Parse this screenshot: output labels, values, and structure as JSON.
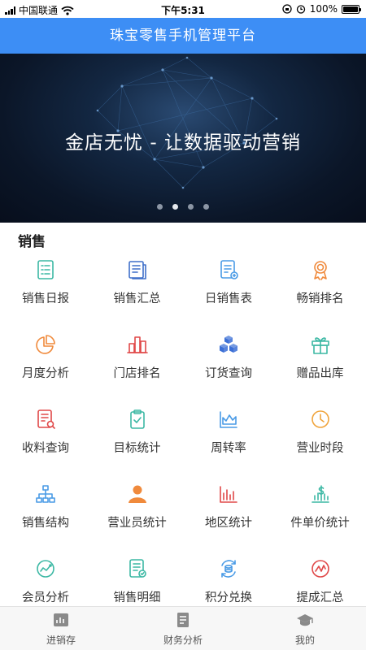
{
  "status_bar": {
    "carrier": "中国联通",
    "time": "下午5:31",
    "battery": "100%",
    "battery_level": 1.0
  },
  "header": {
    "title": "珠宝零售手机管理平台"
  },
  "banner": {
    "text": "金店无忧 - 让数据驱动营销",
    "dot_count": 4,
    "active_dot": 2
  },
  "section": {
    "title": "销售"
  },
  "menu": [
    {
      "label": "销售日报",
      "icon": "daily-report-icon",
      "color": "#3cb8a4"
    },
    {
      "label": "销售汇总",
      "icon": "summary-document-icon",
      "color": "#3f6fc9"
    },
    {
      "label": "日销售表",
      "icon": "daily-sales-sheet-icon",
      "color": "#4a9be6"
    },
    {
      "label": "畅销排名",
      "icon": "award-ribbon-icon",
      "color": "#f08a3c"
    },
    {
      "label": "月度分析",
      "icon": "pie-chart-icon",
      "color": "#f08a3c"
    },
    {
      "label": "门店排名",
      "icon": "store-ranking-icon",
      "color": "#e04848"
    },
    {
      "label": "订货查询",
      "icon": "cubes-icon",
      "color": "#3b6fd6"
    },
    {
      "label": "赠品出库",
      "icon": "gift-icon",
      "color": "#3cb8a4"
    },
    {
      "label": "收料查询",
      "icon": "receipt-search-icon",
      "color": "#e04848"
    },
    {
      "label": "目标统计",
      "icon": "clipboard-check-icon",
      "color": "#3cb8a4"
    },
    {
      "label": "周转率",
      "icon": "turnover-chart-icon",
      "color": "#4a9be6"
    },
    {
      "label": "营业时段",
      "icon": "clock-icon",
      "color": "#f0a43c"
    },
    {
      "label": "销售结构",
      "icon": "org-structure-icon",
      "color": "#4a9be6"
    },
    {
      "label": "营业员统计",
      "icon": "person-icon",
      "color": "#f08a3c"
    },
    {
      "label": "地区统计",
      "icon": "bar-chart-icon",
      "color": "#e04848"
    },
    {
      "label": "件单价统计",
      "icon": "price-growth-icon",
      "color": "#3cb8a4"
    },
    {
      "label": "会员分析",
      "icon": "member-trend-icon",
      "color": "#3cb8a4"
    },
    {
      "label": "销售明细",
      "icon": "sales-detail-icon",
      "color": "#3cb8a4"
    },
    {
      "label": "积分兑换",
      "icon": "points-exchange-icon",
      "color": "#4a9be6"
    },
    {
      "label": "提成汇总",
      "icon": "commission-gauge-icon",
      "color": "#e04848"
    }
  ],
  "tabbar": [
    {
      "label": "进销存",
      "icon": "inventory-chart-icon"
    },
    {
      "label": "财务分析",
      "icon": "finance-document-icon"
    },
    {
      "label": "我的",
      "icon": "graduation-cap-icon"
    }
  ],
  "colors": {
    "header_bg": "#3d8ef5",
    "tabbar_icon": "#8a8a8a"
  }
}
